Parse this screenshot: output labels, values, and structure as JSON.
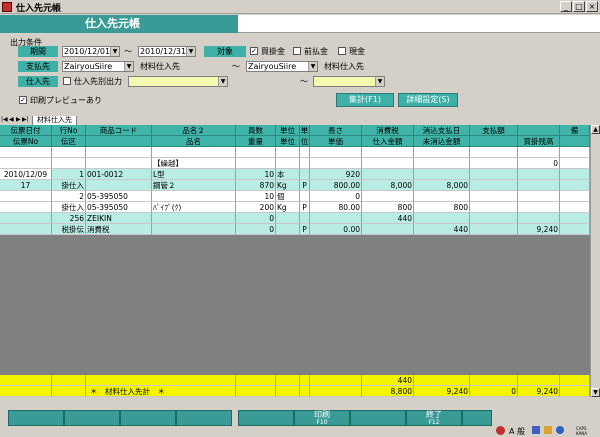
{
  "window": {
    "title": "仕入先元帳",
    "min": "_",
    "max": "□",
    "close": "×"
  },
  "banner": {
    "title": "仕入先元帳"
  },
  "form": {
    "section_label": "出力条件",
    "period_label": "期間",
    "period_from": "2010/12/01",
    "period_to": "2010/12/31",
    "tilde": "～",
    "target_label": "対象",
    "target_options": [
      {
        "label": "買掛金",
        "checked": true
      },
      {
        "label": "前払金",
        "checked": false
      },
      {
        "label": "現金",
        "checked": false
      }
    ],
    "payee_label": "支払先",
    "payee_from_code": "ZairyouSiire",
    "payee_from_name": "材料仕入先",
    "payee_to_code": "ZairyouSiire",
    "payee_to_name": "材料仕入先",
    "supplier_label": "仕入先",
    "supplier_separate": "仕入先別出力",
    "supplier_from": "",
    "supplier_to": "",
    "preview_label": "印刷プレビューあり",
    "preview_checked": true,
    "aggregate_button": "集計(F1)",
    "detail_button": "詳細設定(S)"
  },
  "tab": {
    "label": "材料仕入先",
    "nav": [
      "|◀",
      "◀",
      "▶",
      "▶|"
    ]
  },
  "grid": {
    "header1": [
      "伝票日付",
      "行No",
      "商品コード",
      "品名２",
      "員数",
      "単位",
      "単",
      "長さ",
      "消費税",
      "消込支払日",
      "支払額",
      "",
      "備"
    ],
    "header2": [
      "伝票No",
      "伝区",
      "",
      "品名",
      "重量",
      "単位",
      "位",
      "単価",
      "仕入金額",
      "未消込金額",
      "",
      "買掛残高",
      ""
    ],
    "carry_label": "【繰越】",
    "carry_balance": "0",
    "rows": [
      {
        "r1": [
          "2010/12/09",
          "1",
          "001-0012",
          "L型",
          "10",
          "本",
          "",
          "920",
          "",
          "",
          "",
          "",
          ""
        ],
        "r2": [
          "17",
          "掛仕入",
          "",
          "鋼管２",
          "870",
          "Kg",
          "P",
          "800.00",
          "8,000",
          "8,000",
          "",
          "",
          ""
        ],
        "bg": "c"
      },
      {
        "r1": [
          "",
          "2",
          "05-395050",
          "",
          "10",
          "個",
          "",
          "0",
          "",
          "",
          "",
          "",
          ""
        ],
        "r2": [
          "",
          "掛仕入",
          "05-395050",
          "ﾊﾟｲﾌﾟ(ｸ)",
          "200",
          "Kg",
          "P",
          "80.00",
          "800",
          "800",
          "",
          "",
          ""
        ],
        "bg": "w"
      },
      {
        "r1": [
          "",
          "256",
          "ZEIKIN",
          "",
          "0",
          "",
          "",
          "",
          "440",
          "",
          "",
          "",
          ""
        ],
        "r2": [
          "",
          "税掛伝",
          "消費税",
          "",
          "0",
          "",
          "P",
          "0.00",
          "",
          "440",
          "",
          "9,240",
          ""
        ],
        "bg": "c"
      }
    ],
    "total": {
      "label": "＊　材料仕入先計　＊",
      "tax": "440",
      "amount": "8,800",
      "unreconciled": "9,240",
      "paid": "0",
      "balance": "9,240"
    }
  },
  "fkeys": {
    "print_label": "印刷",
    "print_key": "F10",
    "end_label": "終了",
    "end_key": "F12"
  },
  "status": {
    "ime": "A 般",
    "caps": "CAPS",
    "kana": "KANA"
  }
}
